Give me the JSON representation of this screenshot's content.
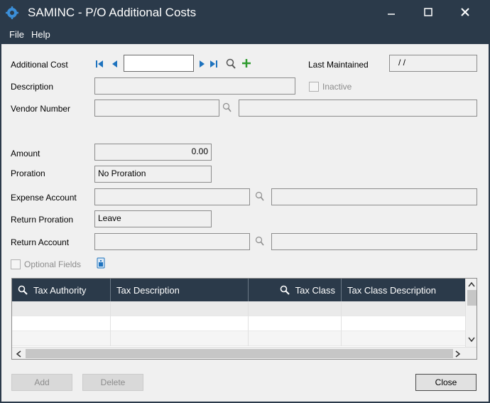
{
  "window": {
    "title": "SAMINC - P/O Additional Costs",
    "minimize_icon": "minimize-icon",
    "maximize_icon": "maximize-icon",
    "close_icon": "close-icon"
  },
  "menu": {
    "items": [
      "File",
      "Help"
    ]
  },
  "form": {
    "additional_cost_label": "Additional Cost",
    "additional_cost_value": "",
    "last_maintained_label": "Last Maintained",
    "last_maintained_value": "/ /",
    "description_label": "Description",
    "description_value": "",
    "inactive_label": "Inactive",
    "vendor_number_label": "Vendor Number",
    "vendor_number_value": "",
    "vendor_name_value": "",
    "amount_label": "Amount",
    "amount_value": "0.00",
    "proration_label": "Proration",
    "proration_value": "No Proration",
    "expense_account_label": "Expense Account",
    "expense_account_value": "",
    "expense_account_desc": "",
    "return_proration_label": "Return Proration",
    "return_proration_value": "Leave",
    "return_account_label": "Return Account",
    "return_account_value": "",
    "return_account_desc": "",
    "optional_fields_label": "Optional Fields"
  },
  "grid": {
    "columns": [
      "Tax Authority",
      "Tax Description",
      "Tax Class",
      "Tax Class Description"
    ],
    "rows": [
      [
        "",
        "",
        "",
        ""
      ],
      [
        "",
        "",
        "",
        ""
      ],
      [
        "",
        "",
        "",
        ""
      ],
      [
        "",
        "",
        "",
        ""
      ]
    ]
  },
  "buttons": {
    "add": "Add",
    "delete": "Delete",
    "close": "Close"
  },
  "colors": {
    "titlebar": "#2b3a4a",
    "nav_blue": "#1e73be",
    "add_green": "#2e9b2e"
  }
}
